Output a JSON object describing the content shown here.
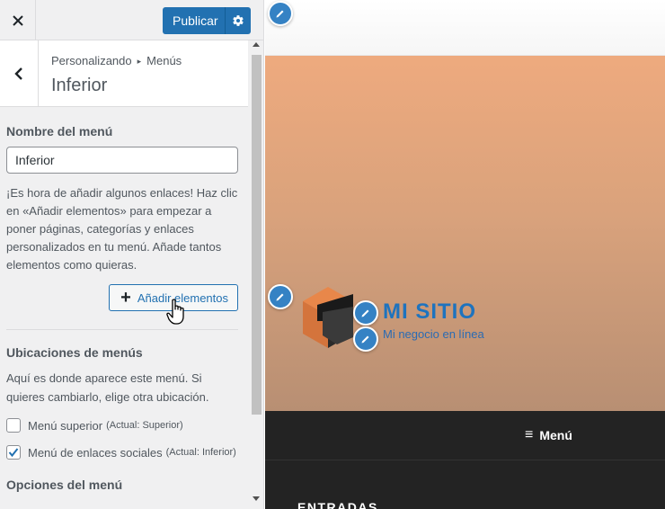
{
  "topbar": {
    "close_icon": "close-icon",
    "publish_label": "Publicar",
    "settings_icon": "gear-icon"
  },
  "section": {
    "breadcrumb_root": "Personalizando",
    "breadcrumb_section": "Menús",
    "title": "Inferior"
  },
  "panel": {
    "menu_name_label": "Nombre del menú",
    "menu_name_value": "Inferior",
    "help_text": "¡Es hora de añadir algunos enlaces! Haz clic en «Añadir elementos» para empezar a poner páginas, categorías y enlaces personalizados en tu menú. Añade tantos elementos como quieras.",
    "add_items_label": "Añadir elementos",
    "locations_title": "Ubicaciones de menús",
    "locations_help": "Aquí es donde aparece este menú. Si quieres cambiarlo, elige otra ubicación.",
    "locations": [
      {
        "label": "Menú superior",
        "current": "(Actual: Superior)",
        "checked": false
      },
      {
        "label": "Menú de enlaces sociales",
        "current": "(Actual: Inferior)",
        "checked": true
      }
    ],
    "options_title": "Opciones del menú"
  },
  "preview": {
    "site_title": "MI SITIO",
    "site_description": "Mi negocio en línea",
    "menu_toggle_label": "Menú",
    "entries_heading": "ENTRADAS"
  },
  "colors": {
    "accent": "#2271b1",
    "hero_top": "#eeaa7e",
    "navbar": "#232323"
  }
}
